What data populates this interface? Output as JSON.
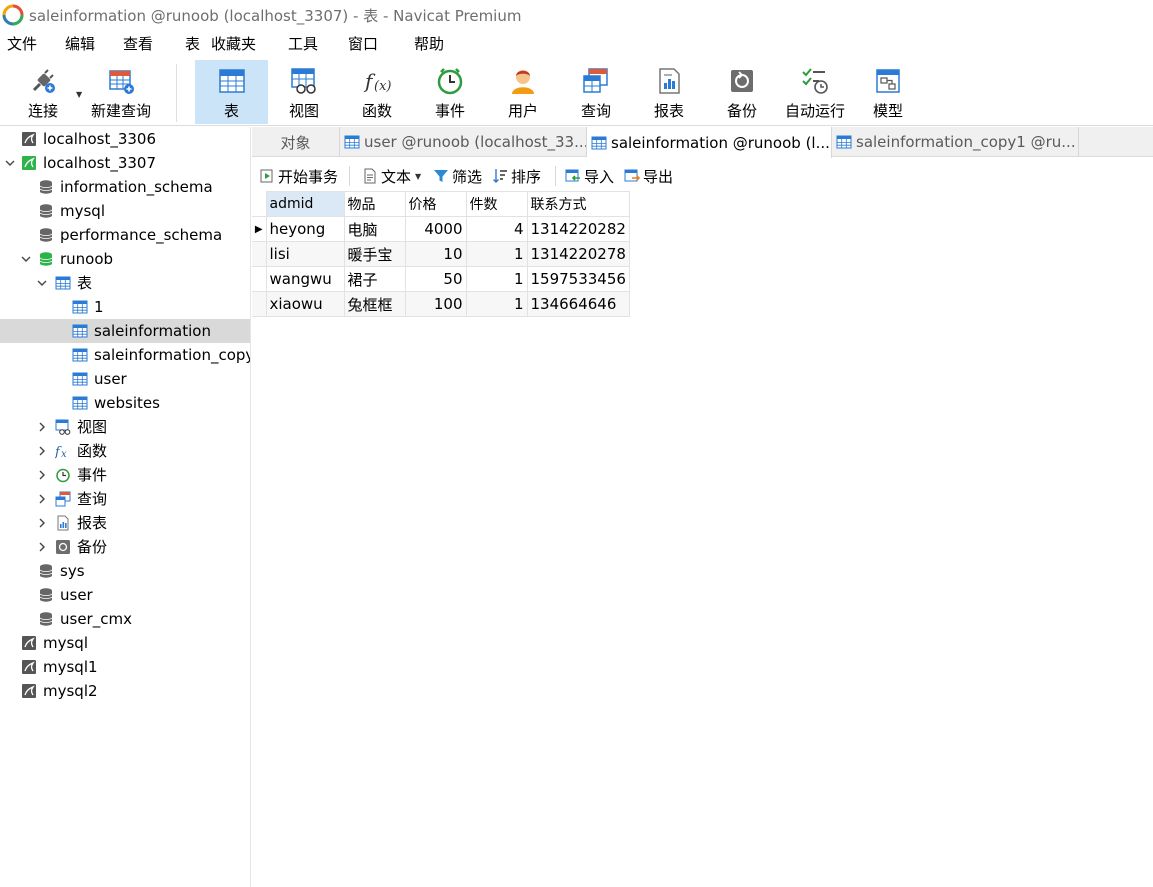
{
  "window": {
    "title": "saleinformation @runoob (localhost_3307) - 表 - Navicat Premium"
  },
  "menu": [
    "文件",
    "编辑",
    "查看",
    "表",
    "收藏夹",
    "工具",
    "窗口",
    "帮助"
  ],
  "toolbar": {
    "connect": "连接",
    "new_query": "新建查询",
    "table": "表",
    "view": "视图",
    "function": "函数",
    "event": "事件",
    "user": "用户",
    "query": "查询",
    "report": "报表",
    "backup": "备份",
    "automation": "自动运行",
    "model": "模型"
  },
  "sidebar": {
    "items": [
      {
        "label": "localhost_3306"
      },
      {
        "label": "localhost_3307"
      },
      {
        "label": "information_schema"
      },
      {
        "label": "mysql"
      },
      {
        "label": "performance_schema"
      },
      {
        "label": "runoob"
      },
      {
        "label": "表"
      },
      {
        "label": "1"
      },
      {
        "label": "saleinformation"
      },
      {
        "label": "saleinformation_copy"
      },
      {
        "label": "user"
      },
      {
        "label": "websites"
      },
      {
        "label": "视图"
      },
      {
        "label": "函数"
      },
      {
        "label": "事件"
      },
      {
        "label": "查询"
      },
      {
        "label": "报表"
      },
      {
        "label": "备份"
      },
      {
        "label": "sys"
      },
      {
        "label": "user"
      },
      {
        "label": "user_cmx"
      },
      {
        "label": "mysql"
      },
      {
        "label": "mysql1"
      },
      {
        "label": "mysql2"
      }
    ]
  },
  "tabs": [
    {
      "label": "对象"
    },
    {
      "label": "user @runoob (localhost_33..."
    },
    {
      "label": "saleinformation @runoob (l..."
    },
    {
      "label": "saleinformation_copy1 @ru..."
    }
  ],
  "objbar": {
    "begin_transaction": "开始事务",
    "text": "文本",
    "filter": "筛选",
    "sort": "排序",
    "import": "导入",
    "export": "导出"
  },
  "grid": {
    "columns": [
      "admid",
      "物品",
      "价格",
      "件数",
      "联系方式"
    ],
    "rows": [
      [
        "heyong",
        "电脑",
        "4000",
        "4",
        "1314220282"
      ],
      [
        "lisi",
        "暖手宝",
        "10",
        "1",
        "1314220278"
      ],
      [
        "wangwu",
        "裙子",
        "50",
        "1",
        "1597533456"
      ],
      [
        "xiaowu",
        "兔框框",
        "100",
        "1",
        "134664646"
      ]
    ]
  },
  "colors": {
    "accent": "#cce4f7",
    "selected_row": "#d9d9d9",
    "db_green": "#2db34a"
  }
}
